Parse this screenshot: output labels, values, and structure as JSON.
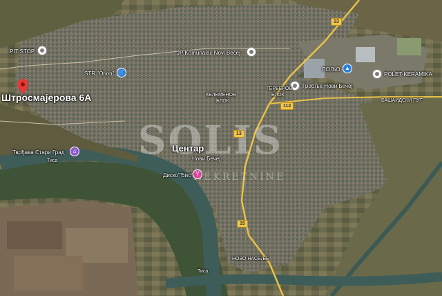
{
  "labels": {
    "pit_stop": "PIT STOP",
    "jp_komunalac": "JP Komunalac Novi Bečej",
    "str_orion": "STR \"Orion\"",
    "poljo": "ПОЉО",
    "grobl": "Гробље Нови Бечеј",
    "polet": "POLET-KERAMIKA",
    "kelemenov": "КЕЛЕМЕНОВ",
    "kelemenov2": "БЛОК",
    "gerberov": "ГЕРБЕРОВ",
    "gerberov2": "БЛОК",
    "bashaidski": "БАШАИДСКИ ПУТ",
    "tardjava": "Тврђава Стари Град",
    "tisa1": "Тиса",
    "tisa2": "Тиса",
    "centar": "Центар",
    "novi_becej": "Нови Бечеј",
    "disko": "Диско\"Ђис\"",
    "novo_naselje": "НОВО НАСЕЉЕ",
    "address": "Штросмајерова 6А"
  },
  "roads": {
    "r13a": "13",
    "r13b": "13",
    "r13c": "13",
    "r15": "15",
    "r112": "112"
  },
  "watermark": {
    "line1": "SOLIS",
    "line2": "NEKRETNINE"
  },
  "colors": {
    "pin_red": "#e53935",
    "pin_blue": "#2d7fe0",
    "pin_pink": "#d9479d",
    "pin_purple": "#8e5bd0",
    "river": "#3f5d58",
    "road": "#e8c14a"
  },
  "icons": {
    "gray_pin": "location-circle-icon",
    "shop": "cart-icon",
    "mall": "shopping-bag-icon",
    "museum": "museum-icon",
    "bar": "cocktail-icon",
    "address_pin": "map-pin-icon"
  }
}
